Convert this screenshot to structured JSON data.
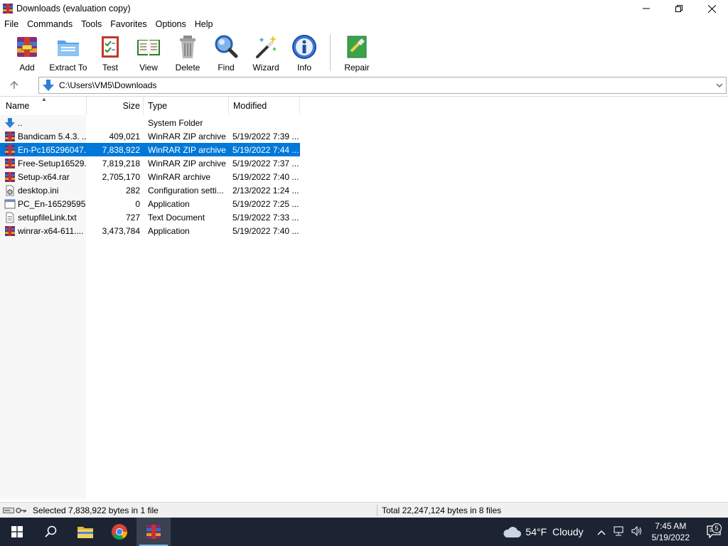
{
  "window": {
    "title": "Downloads (evaluation copy)",
    "controls": {
      "minimize": "—",
      "maximize": "❐",
      "close": "✕"
    }
  },
  "menu": [
    "File",
    "Commands",
    "Tools",
    "Favorites",
    "Options",
    "Help"
  ],
  "toolbar": {
    "buttons": [
      {
        "label": "Add",
        "icon": "add-archive-icon"
      },
      {
        "label": "Extract To",
        "icon": "extract-folder-icon"
      },
      {
        "label": "Test",
        "icon": "test-checklist-icon"
      },
      {
        "label": "View",
        "icon": "view-book-icon"
      },
      {
        "label": "Delete",
        "icon": "trash-can-icon"
      },
      {
        "label": "Find",
        "icon": "magnifier-icon"
      },
      {
        "label": "Wizard",
        "icon": "magic-wand-icon"
      },
      {
        "label": "Info",
        "icon": "info-icon"
      },
      {
        "label": "Repair",
        "icon": "repair-kit-icon"
      }
    ]
  },
  "address": {
    "path": "C:\\Users\\VM5\\Downloads"
  },
  "columns": {
    "name": "Name",
    "size": "Size",
    "type": "Type",
    "modified": "Modified"
  },
  "files": [
    {
      "name": "..",
      "size": "",
      "type": "System Folder",
      "modified": "",
      "icon": "up-folder-icon",
      "selected": false
    },
    {
      "name": "Bandicam 5.4.3. ...",
      "size": "409,021",
      "type": "WinRAR ZIP archive",
      "modified": "5/19/2022 7:39 ...",
      "icon": "winrar-archive-icon",
      "selected": false
    },
    {
      "name": "En-Pc165296047...",
      "size": "7,838,922",
      "type": "WinRAR ZIP archive",
      "modified": "5/19/2022 7:44 ...",
      "icon": "winrar-archive-icon",
      "selected": true
    },
    {
      "name": "Free-Setup16529...",
      "size": "7,819,218",
      "type": "WinRAR ZIP archive",
      "modified": "5/19/2022 7:37 ...",
      "icon": "winrar-archive-icon",
      "selected": false
    },
    {
      "name": "Setup-x64.rar",
      "size": "2,705,170",
      "type": "WinRAR archive",
      "modified": "5/19/2022 7:40 ...",
      "icon": "winrar-archive-icon",
      "selected": false
    },
    {
      "name": "desktop.ini",
      "size": "282",
      "type": "Configuration setti...",
      "modified": "2/13/2022 1:24 ...",
      "icon": "settings-file-icon",
      "selected": false
    },
    {
      "name": "PC_En-16529595...",
      "size": "0",
      "type": "Application",
      "modified": "5/19/2022 7:25 ...",
      "icon": "application-icon",
      "selected": false
    },
    {
      "name": "setupfileLink.txt",
      "size": "727",
      "type": "Text Document",
      "modified": "5/19/2022 7:33 ...",
      "icon": "text-file-icon",
      "selected": false
    },
    {
      "name": "winrar-x64-611....",
      "size": "3,473,784",
      "type": "Application",
      "modified": "5/19/2022 7:40 ...",
      "icon": "winrar-archive-icon",
      "selected": false
    }
  ],
  "status": {
    "left": "Selected 7,838,922 bytes in 1 file",
    "right": "Total 22,247,124 bytes in 8 files"
  },
  "taskbar": {
    "weather_temp": "54°F",
    "weather_desc": "Cloudy",
    "time": "7:45 AM",
    "date": "5/19/2022",
    "notification_count": "5"
  },
  "colors": {
    "selection": "#0078d7",
    "taskbar": "#1c2433"
  }
}
